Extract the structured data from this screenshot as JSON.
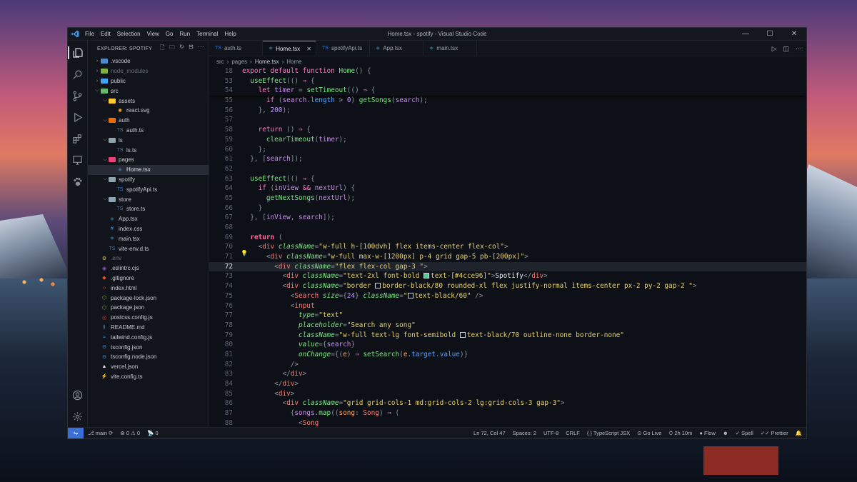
{
  "app": {
    "window_title": "Home.tsx - spotify - Visual Studio Code",
    "menu": [
      "File",
      "Edit",
      "Selection",
      "View",
      "Go",
      "Run",
      "Terminal",
      "Help"
    ]
  },
  "window_controls": {
    "minimize": "—",
    "maximize": "☐",
    "close": "✕"
  },
  "sidebar": {
    "title": "EXPLORER: SPOTIFY",
    "tree": [
      {
        "label": ".vscode",
        "type": "folder",
        "depth": 0,
        "open": false,
        "color": "#4f8cc9"
      },
      {
        "label": "node_modules",
        "type": "folder",
        "depth": 0,
        "open": false,
        "color": "#7cb342",
        "dim": true
      },
      {
        "label": "public",
        "type": "folder",
        "depth": 0,
        "open": false,
        "color": "#42a5f5"
      },
      {
        "label": "src",
        "type": "folder",
        "depth": 0,
        "open": true,
        "color": "#66bb6a"
      },
      {
        "label": "assets",
        "type": "folder",
        "depth": 1,
        "open": true,
        "color": "#ffca28"
      },
      {
        "label": "react.svg",
        "type": "file",
        "depth": 2,
        "icon": "✺",
        "icolor": "#ffb300"
      },
      {
        "label": "auth",
        "type": "folder",
        "depth": 1,
        "open": true,
        "color": "#ef6c00"
      },
      {
        "label": "auth.ts",
        "type": "file",
        "depth": 2,
        "icon": "TS",
        "icolor": "#3178c6"
      },
      {
        "label": "ls",
        "type": "folder",
        "depth": 1,
        "open": true,
        "color": "#90a4ae"
      },
      {
        "label": "ls.ts",
        "type": "file",
        "depth": 2,
        "icon": "TS",
        "icolor": "#3178c6"
      },
      {
        "label": "pages",
        "type": "folder",
        "depth": 1,
        "open": true,
        "color": "#ec407a"
      },
      {
        "label": "Home.tsx",
        "type": "file",
        "depth": 2,
        "icon": "⚛",
        "icolor": "#4fc3f7",
        "selected": true
      },
      {
        "label": "spotify",
        "type": "folder",
        "depth": 1,
        "open": true,
        "color": "#90a4ae"
      },
      {
        "label": "spotifyApi.ts",
        "type": "file",
        "depth": 2,
        "icon": "TS",
        "icolor": "#3178c6"
      },
      {
        "label": "store",
        "type": "folder",
        "depth": 1,
        "open": true,
        "color": "#90a4ae"
      },
      {
        "label": "store.ts",
        "type": "file",
        "depth": 2,
        "icon": "TS",
        "icolor": "#3178c6"
      },
      {
        "label": "App.tsx",
        "type": "file",
        "depth": 1,
        "icon": "⚛",
        "icolor": "#4fc3f7"
      },
      {
        "label": "index.css",
        "type": "file",
        "depth": 1,
        "icon": "#",
        "icolor": "#42a5f5"
      },
      {
        "label": "main.tsx",
        "type": "file",
        "depth": 1,
        "icon": "⚛",
        "icolor": "#4fc3f7"
      },
      {
        "label": "vite-env.d.ts",
        "type": "file",
        "depth": 1,
        "icon": "TS",
        "icolor": "#3178c6"
      },
      {
        "label": ".env",
        "type": "file",
        "depth": 0,
        "icon": "⚙",
        "icolor": "#e6c84b",
        "dim": true
      },
      {
        "label": ".eslintrc.cjs",
        "type": "file",
        "depth": 0,
        "icon": "◉",
        "icolor": "#7e57c2"
      },
      {
        "label": ".gitignore",
        "type": "file",
        "depth": 0,
        "icon": "◆",
        "icolor": "#f4511e"
      },
      {
        "label": "index.html",
        "type": "file",
        "depth": 0,
        "icon": "‹›",
        "icolor": "#e44d26"
      },
      {
        "label": "package-lock.json",
        "type": "file",
        "depth": 0,
        "icon": "⬡",
        "icolor": "#8bc34a"
      },
      {
        "label": "package.json",
        "type": "file",
        "depth": 0,
        "icon": "⬡",
        "icolor": "#8bc34a"
      },
      {
        "label": "postcss.config.js",
        "type": "file",
        "depth": 0,
        "icon": "◎",
        "icolor": "#e53935"
      },
      {
        "label": "README.md",
        "type": "file",
        "depth": 0,
        "icon": "ℹ",
        "icolor": "#42a5f5"
      },
      {
        "label": "tailwind.config.js",
        "type": "file",
        "depth": 0,
        "icon": "≈",
        "icolor": "#38bdf8"
      },
      {
        "label": "tsconfig.json",
        "type": "file",
        "depth": 0,
        "icon": "⚙",
        "icolor": "#3178c6"
      },
      {
        "label": "tsconfig.node.json",
        "type": "file",
        "depth": 0,
        "icon": "⚙",
        "icolor": "#3178c6"
      },
      {
        "label": "vercel.json",
        "type": "file",
        "depth": 0,
        "icon": "▲",
        "icolor": "#e6e8ee"
      },
      {
        "label": "vite.config.ts",
        "type": "file",
        "depth": 0,
        "icon": "⚡",
        "icolor": "#ffca28"
      }
    ]
  },
  "tabs": [
    {
      "label": "auth.ts",
      "icon": "TS",
      "icolor": "#3178c6",
      "active": false
    },
    {
      "label": "Home.tsx",
      "icon": "⚛",
      "icolor": "#4fc3f7",
      "active": true
    },
    {
      "label": "spotifyApi.ts",
      "icon": "TS",
      "icolor": "#3178c6",
      "active": false
    },
    {
      "label": "App.tsx",
      "icon": "⚛",
      "icolor": "#4fc3f7",
      "active": false
    },
    {
      "label": "main.tsx",
      "icon": "⚛",
      "icolor": "#4fc3f7",
      "active": false
    }
  ],
  "tab_close": "✕",
  "breadcrumb": [
    "src",
    "pages",
    "Home.tsx",
    "Home"
  ],
  "code": [
    {
      "n": "18",
      "sticky": true,
      "t": [
        [
          "kw",
          "export "
        ],
        [
          "kw",
          "default "
        ],
        [
          "kw",
          "function "
        ],
        [
          "fn",
          "Home"
        ],
        [
          "pu",
          "() {"
        ]
      ]
    },
    {
      "n": "53",
      "sticky": true,
      "t": [
        [
          "pu",
          "  "
        ],
        [
          "fn",
          "useEffect"
        ],
        [
          "pu",
          "(() "
        ],
        [
          "kw",
          "⇒"
        ],
        [
          "pu",
          " {"
        ]
      ]
    },
    {
      "n": "54",
      "sticky": true,
      "t": [
        [
          "pu",
          "    "
        ],
        [
          "kw",
          "let "
        ],
        [
          "vr",
          "timer"
        ],
        [
          "pu",
          " = "
        ],
        [
          "fn",
          "setTimeout"
        ],
        [
          "pu",
          "(() "
        ],
        [
          "kw",
          "⇒"
        ],
        [
          "pu",
          " {"
        ]
      ]
    },
    {
      "n": "55",
      "t": [
        [
          "pu",
          "      "
        ],
        [
          "kw",
          "if"
        ],
        [
          "pu",
          " ("
        ],
        [
          "vr",
          "search"
        ],
        [
          "pu",
          "."
        ],
        [
          "prop",
          "length"
        ],
        [
          "pu",
          " > "
        ],
        [
          "nm",
          "0"
        ],
        [
          "pu",
          ") "
        ],
        [
          "fn",
          "getSongs"
        ],
        [
          "pu",
          "("
        ],
        [
          "vr",
          "search"
        ],
        [
          "pu",
          ");"
        ]
      ]
    },
    {
      "n": "56",
      "t": [
        [
          "pu",
          "    }, "
        ],
        [
          "nm",
          "200"
        ],
        [
          "pu",
          ");"
        ]
      ]
    },
    {
      "n": "57",
      "t": []
    },
    {
      "n": "58",
      "t": [
        [
          "pu",
          "    "
        ],
        [
          "kw",
          "return"
        ],
        [
          "pu",
          " () "
        ],
        [
          "kw",
          "⇒"
        ],
        [
          "pu",
          " {"
        ]
      ]
    },
    {
      "n": "59",
      "t": [
        [
          "pu",
          "      "
        ],
        [
          "fn",
          "clearTimeout"
        ],
        [
          "pu",
          "("
        ],
        [
          "vr",
          "timer"
        ],
        [
          "pu",
          ");"
        ]
      ]
    },
    {
      "n": "60",
      "t": [
        [
          "pu",
          "    };"
        ]
      ]
    },
    {
      "n": "61",
      "t": [
        [
          "pu",
          "  }, ["
        ],
        [
          "vr",
          "search"
        ],
        [
          "pu",
          "]);"
        ]
      ]
    },
    {
      "n": "62",
      "t": []
    },
    {
      "n": "63",
      "t": [
        [
          "pu",
          "  "
        ],
        [
          "fn",
          "useEffect"
        ],
        [
          "pu",
          "(() "
        ],
        [
          "kw",
          "⇒"
        ],
        [
          "pu",
          " {"
        ]
      ]
    },
    {
      "n": "64",
      "t": [
        [
          "pu",
          "    "
        ],
        [
          "kw",
          "if"
        ],
        [
          "pu",
          " ("
        ],
        [
          "vr",
          "inView"
        ],
        [
          "pu",
          " "
        ],
        [
          "kw",
          "&&"
        ],
        [
          "pu",
          " "
        ],
        [
          "vr",
          "nextUrl"
        ],
        [
          "pu",
          ") {"
        ]
      ]
    },
    {
      "n": "65",
      "t": [
        [
          "pu",
          "      "
        ],
        [
          "fn",
          "getNextSongs"
        ],
        [
          "pu",
          "("
        ],
        [
          "vr",
          "nextUrl"
        ],
        [
          "pu",
          ");"
        ]
      ]
    },
    {
      "n": "66",
      "t": [
        [
          "pu",
          "    }"
        ]
      ]
    },
    {
      "n": "67",
      "t": [
        [
          "pu",
          "  }, ["
        ],
        [
          "vr",
          "inView"
        ],
        [
          "pu",
          ", "
        ],
        [
          "vr",
          "search"
        ],
        [
          "pu",
          "]);"
        ]
      ]
    },
    {
      "n": "68",
      "t": []
    },
    {
      "n": "69",
      "t": [
        [
          "pu",
          "  "
        ],
        [
          "k2",
          "return"
        ],
        [
          "pu",
          " ("
        ]
      ]
    },
    {
      "n": "70",
      "t": [
        [
          "pu",
          "    <"
        ],
        [
          "tag",
          "div"
        ],
        [
          "pu",
          " "
        ],
        [
          "attr",
          "className"
        ],
        [
          "pu",
          "="
        ],
        [
          "str",
          "\"w-full h-[100dvh] flex items-center flex-col\""
        ],
        [
          "pu",
          ">"
        ]
      ]
    },
    {
      "n": "71",
      "t": [
        [
          "pu",
          "      <"
        ],
        [
          "tag",
          "div"
        ],
        [
          "pu",
          " "
        ],
        [
          "attr",
          "className"
        ],
        [
          "pu",
          "="
        ],
        [
          "str",
          "\"w-full max-w-[1200px] p-4 grid gap-5 pb-[200px]\""
        ],
        [
          "pu",
          ">"
        ]
      ]
    },
    {
      "n": "72",
      "cur": true,
      "t": [
        [
          "pu",
          "        <"
        ],
        [
          "tag",
          "div"
        ],
        [
          "pu",
          " "
        ],
        [
          "attr",
          "className"
        ],
        [
          "pu",
          "="
        ],
        [
          "str",
          "\"flex flex-col gap-3 \""
        ],
        [
          "pu",
          ">"
        ]
      ]
    },
    {
      "n": "73",
      "t": [
        [
          "pu",
          "          <"
        ],
        [
          "tag",
          "div"
        ],
        [
          "pu",
          " "
        ],
        [
          "attr",
          "className"
        ],
        [
          "pu",
          "="
        ],
        [
          "str",
          "\"text-2xl font-bold "
        ],
        [
          "sw",
          "#4cce96"
        ],
        [
          "str",
          "text-[#4cce96]\""
        ],
        [
          "pu",
          ">"
        ],
        [
          "jsx",
          "Spotify"
        ],
        [
          "pu",
          "</"
        ],
        [
          "tag",
          "div"
        ],
        [
          "pu",
          ">"
        ]
      ]
    },
    {
      "n": "74",
      "t": [
        [
          "pu",
          "          <"
        ],
        [
          "tag",
          "div"
        ],
        [
          "pu",
          " "
        ],
        [
          "attr",
          "className"
        ],
        [
          "pu",
          "="
        ],
        [
          "str",
          "\"border "
        ],
        [
          "sw",
          "transparent"
        ],
        [
          "str",
          "border-black/80 rounded-xl flex justify-normal items-center px-2 py-2 gap-2 \""
        ],
        [
          "pu",
          ">"
        ]
      ]
    },
    {
      "n": "75",
      "t": [
        [
          "pu",
          "            <"
        ],
        [
          "tag",
          "Search"
        ],
        [
          "pu",
          " "
        ],
        [
          "attr",
          "size"
        ],
        [
          "pu",
          "={"
        ],
        [
          "nm",
          "24"
        ],
        [
          "pu",
          "} "
        ],
        [
          "attr",
          "className"
        ],
        [
          "pu",
          "="
        ],
        [
          "str",
          "\""
        ],
        [
          "sw",
          "transparent"
        ],
        [
          "str",
          "text-black/60\""
        ],
        [
          "pu",
          " />"
        ]
      ]
    },
    {
      "n": "76",
      "t": [
        [
          "pu",
          "            <"
        ],
        [
          "tag",
          "input"
        ]
      ]
    },
    {
      "n": "77",
      "t": [
        [
          "pu",
          "              "
        ],
        [
          "attr",
          "type"
        ],
        [
          "pu",
          "="
        ],
        [
          "str",
          "\"text\""
        ]
      ]
    },
    {
      "n": "78",
      "t": [
        [
          "pu",
          "              "
        ],
        [
          "attr",
          "placeholder"
        ],
        [
          "pu",
          "="
        ],
        [
          "str",
          "\"Search any song\""
        ]
      ]
    },
    {
      "n": "79",
      "t": [
        [
          "pu",
          "              "
        ],
        [
          "attr",
          "className"
        ],
        [
          "pu",
          "="
        ],
        [
          "str",
          "\"w-full text-lg font-semibold "
        ],
        [
          "sw",
          "transparent"
        ],
        [
          "str",
          "text-black/70 outline-none border-none\""
        ]
      ]
    },
    {
      "n": "80",
      "t": [
        [
          "pu",
          "              "
        ],
        [
          "attr",
          "value"
        ],
        [
          "pu",
          "={"
        ],
        [
          "vr",
          "search"
        ],
        [
          "pu",
          "}"
        ]
      ]
    },
    {
      "n": "81",
      "t": [
        [
          "pu",
          "              "
        ],
        [
          "attr",
          "onChange"
        ],
        [
          "pu",
          "={("
        ],
        [
          "par",
          "e"
        ],
        [
          "pu",
          ") "
        ],
        [
          "kw",
          "⇒"
        ],
        [
          "pu",
          " "
        ],
        [
          "fn",
          "setSearch"
        ],
        [
          "pu",
          "("
        ],
        [
          "par",
          "e"
        ],
        [
          "pu",
          "."
        ],
        [
          "prop",
          "target"
        ],
        [
          "pu",
          "."
        ],
        [
          "prop",
          "value"
        ],
        [
          "pu",
          ")}"
        ]
      ]
    },
    {
      "n": "82",
      "t": [
        [
          "pu",
          "            />"
        ]
      ]
    },
    {
      "n": "83",
      "t": [
        [
          "pu",
          "          </"
        ],
        [
          "tag",
          "div"
        ],
        [
          "pu",
          ">"
        ]
      ]
    },
    {
      "n": "84",
      "t": [
        [
          "pu",
          "        </"
        ],
        [
          "tag",
          "div"
        ],
        [
          "pu",
          ">"
        ]
      ]
    },
    {
      "n": "85",
      "t": [
        [
          "pu",
          "        <"
        ],
        [
          "tag",
          "div"
        ],
        [
          "pu",
          ">"
        ]
      ]
    },
    {
      "n": "86",
      "t": [
        [
          "pu",
          "          <"
        ],
        [
          "tag",
          "div"
        ],
        [
          "pu",
          " "
        ],
        [
          "attr",
          "className"
        ],
        [
          "pu",
          "="
        ],
        [
          "str",
          "\"grid grid-cols-1 md:grid-cols-2 lg:grid-cols-3 gap-3\""
        ],
        [
          "pu",
          ">"
        ]
      ]
    },
    {
      "n": "87",
      "t": [
        [
          "pu",
          "            {"
        ],
        [
          "vr",
          "songs"
        ],
        [
          "pu",
          "."
        ],
        [
          "fn",
          "map"
        ],
        [
          "pu",
          "(("
        ],
        [
          "par",
          "song"
        ],
        [
          "pu",
          ": "
        ],
        [
          "tag",
          "Song"
        ],
        [
          "pu",
          ") "
        ],
        [
          "kw",
          "⇒"
        ],
        [
          "pu",
          " ("
        ]
      ]
    },
    {
      "n": "88",
      "t": [
        [
          "pu",
          "              <"
        ],
        [
          "tag",
          "Song"
        ]
      ]
    }
  ],
  "status": {
    "branch": "main",
    "sync": "⟳",
    "errors": "0",
    "warnings": "0",
    "ports": "0",
    "position": "Ln 72, Col 47",
    "spaces": "Spaces: 2",
    "encoding": "UTF-8",
    "eol": "CRLF",
    "language": "{ } TypeScript JSX",
    "golive": "Go Live",
    "time": "2h 10m",
    "flow": "Flow",
    "spell": "Spell",
    "prettier": "Prettier"
  }
}
